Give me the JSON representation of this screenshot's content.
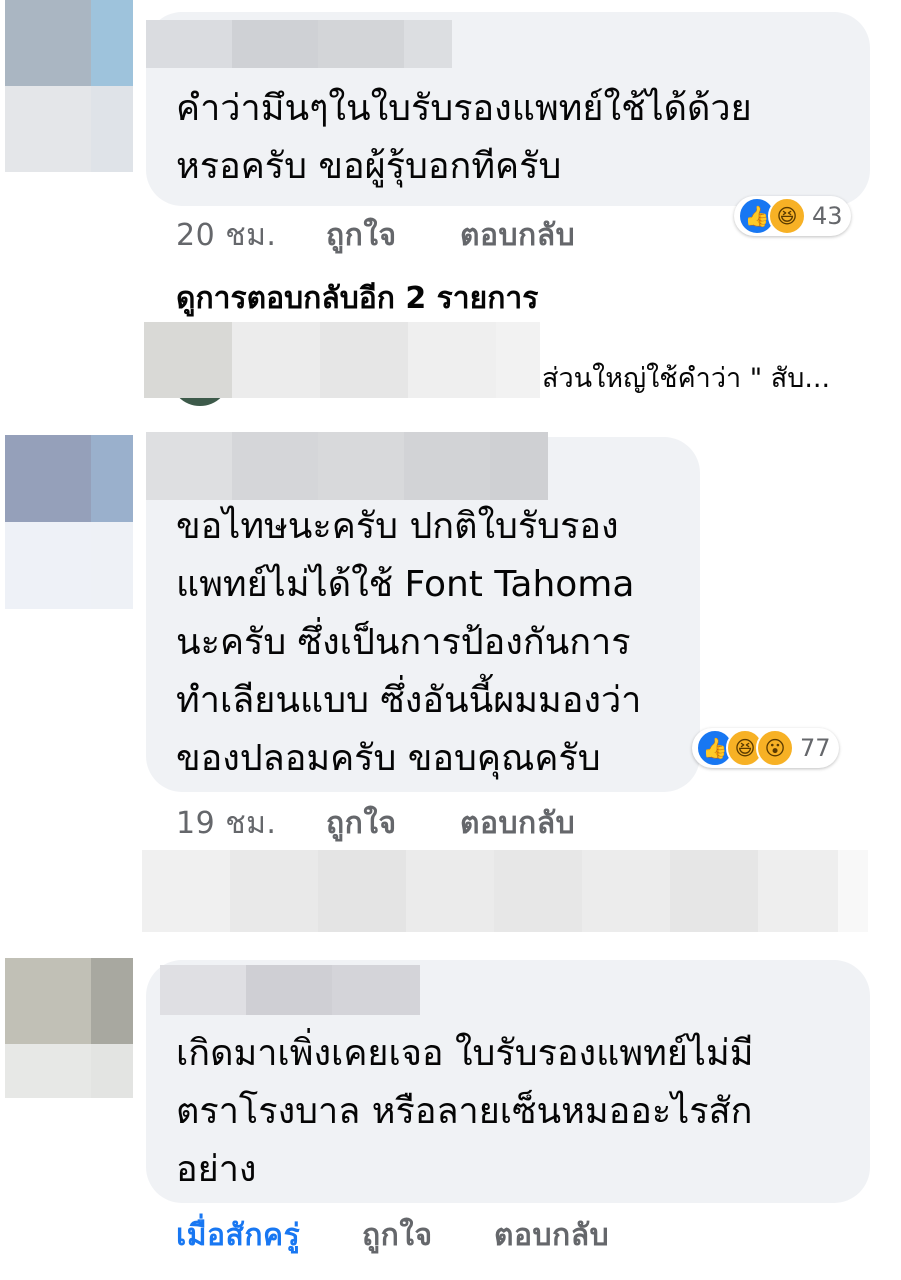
{
  "comments": [
    {
      "text": "คำว่ามึนๆในใบรับรองแพทย์ใช้ได้ด้วย\nหรอครับ ขอผู้รุ้บอกทีครับ",
      "time": "20 ชม.",
      "like_label": "ถูกใจ",
      "reply_label": "ตอบกลับ",
      "reactions": [
        "like-icon",
        "haha-icon"
      ],
      "reaction_count": "43"
    },
    {
      "text": "ขอไทษนะครับ ปกติใบรับรอง\nแพทย์ไม่ได้ใช้ Font Tahoma\nนะครับ ซึ่งเป็นการป้องกันการ\nทำเลียนแบบ ซึ่งอันนี้ผมมองว่า\nของปลอมครับ  ขอบคุณครับ",
      "time": "19 ชม.",
      "like_label": "ถูกใจ",
      "reply_label": "ตอบกลับ",
      "reactions": [
        "like-icon",
        "haha-icon",
        "wow-icon"
      ],
      "reaction_count": "77"
    },
    {
      "text": "เกิดมาเพิ่งเคยเจอ ใบรับรองแพทย์ไม่มี\nตราโรงบาล หรือลายเซ็นหมออะไรสัก\nอย่าง",
      "time": "เมื่อสักครู่",
      "like_label": "ถูกใจ",
      "reply_label": "ตอบกลับ"
    }
  ],
  "more_replies": "ดูการตอบกลับอีก 2 รายการ",
  "reply_preview": "ส่วนใหญ่ใช้คำว่า \" สับ...",
  "colors": {
    "bubble": "#f0f2f5",
    "link_blue": "#1877f2",
    "meta_gray": "#65676b"
  }
}
